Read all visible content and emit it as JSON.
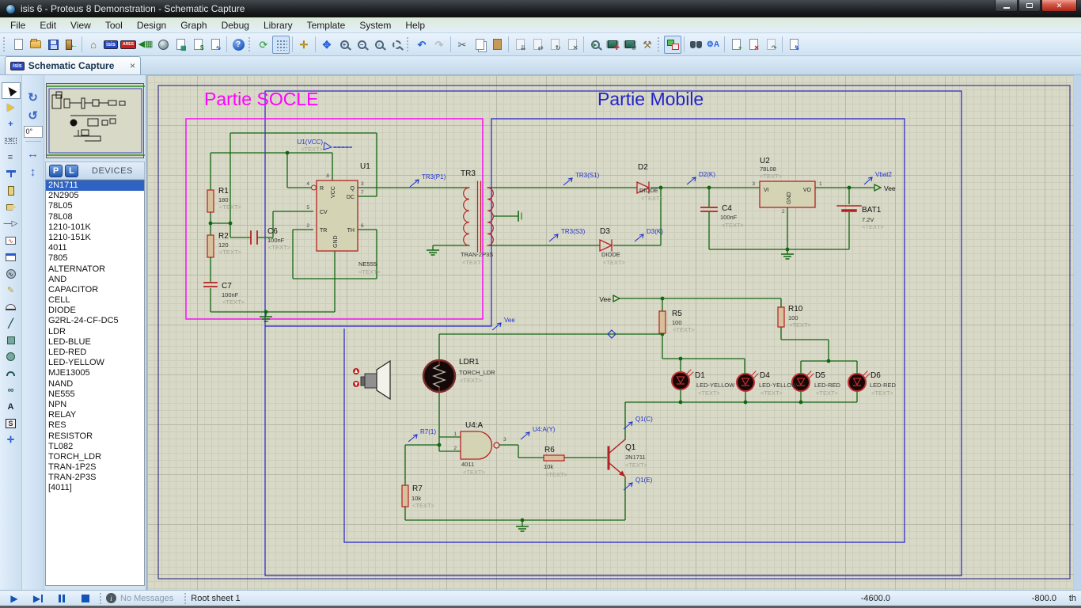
{
  "window": {
    "title": "isis 6 - Proteus 8 Demonstration - Schematic Capture"
  },
  "menu": {
    "items": [
      "File",
      "Edit",
      "View",
      "Tool",
      "Design",
      "Graph",
      "Debug",
      "Library",
      "Template",
      "System",
      "Help"
    ]
  },
  "toolbar": {
    "isis_badge": "isis",
    "ares_badge": "ARES"
  },
  "tab": {
    "label": "Schematic Capture",
    "close": "×"
  },
  "sidebar": {
    "rotation_angle": "0°",
    "p_button": "P",
    "l_button": "L",
    "devices_header": "DEVICES",
    "selected_device": "2N1711",
    "devices": [
      "2N1711",
      "2N2905",
      "78L05",
      "78L08",
      "1210-101K",
      "1210-151K",
      "4011",
      "7805",
      "ALTERNATOR",
      "AND",
      "CAPACITOR",
      "CELL",
      "DIODE",
      "G2RL-24-CF-DC5",
      "LDR",
      "LED-BLUE",
      "LED-RED",
      "LED-YELLOW",
      "MJE13005",
      "NAND",
      "NE555",
      "NPN",
      "RELAY",
      "RES",
      "RESISTOR",
      "TL082",
      "TORCH_LDR",
      "TRAN-1P2S",
      "TRAN-2P3S",
      "[4011]"
    ]
  },
  "statusbar": {
    "message": "No Messages",
    "sheet": "Root sheet 1",
    "coord_x": "-4600.0",
    "coord_y": "-800.0",
    "units": "th"
  },
  "schematic": {
    "titles": {
      "socle": "Partie SOCLE",
      "mobile": "Partie Mobile"
    },
    "placeholder": "<TEXT>",
    "components": [
      {
        "ref": "R1",
        "val": "180"
      },
      {
        "ref": "R2",
        "val": "120"
      },
      {
        "ref": "C6",
        "val": "100nF"
      },
      {
        "ref": "C7",
        "val": "100nF"
      },
      {
        "ref": "U1",
        "val": "NE555"
      },
      {
        "ref": "TR3",
        "val": "TRAN-2P3S"
      },
      {
        "ref": "D2",
        "val": "DIODE"
      },
      {
        "ref": "D3",
        "val": "DIODE"
      },
      {
        "ref": "C4",
        "val": "100nF"
      },
      {
        "ref": "U2",
        "val": "78L08"
      },
      {
        "ref": "BAT1",
        "val": "7.2V"
      },
      {
        "ref": "R5",
        "val": "100"
      },
      {
        "ref": "R10",
        "val": "100"
      },
      {
        "ref": "LDR1",
        "val": "TORCH_LDR"
      },
      {
        "ref": "D1",
        "val": "LED-YELLOW"
      },
      {
        "ref": "D4",
        "val": "LED-YELLOW"
      },
      {
        "ref": "D5",
        "val": "LED-RED"
      },
      {
        "ref": "D6",
        "val": "LED-RED"
      },
      {
        "ref": "U4:A",
        "val": "4011"
      },
      {
        "ref": "R6",
        "val": "10k"
      },
      {
        "ref": "R7",
        "val": "10k"
      },
      {
        "ref": "Q1",
        "val": "2N1711"
      }
    ],
    "u1_pins": {
      "r": "R",
      "cv": "CV",
      "tr": "TR",
      "q": "Q",
      "dc": "DC",
      "th": "TH",
      "vcc": "VCC",
      "gnd": "GND",
      "n4": "4",
      "n5": "5",
      "n2": "2",
      "n8": "8",
      "n3": "3",
      "n7": "7",
      "n6": "6"
    },
    "u2_pins": {
      "vi": "VI",
      "vo": "VO",
      "gnd": "GND",
      "n3": "3",
      "n1": "1",
      "n2": "2"
    },
    "u4_pins": {
      "n1": "1",
      "n2": "2",
      "n3": "3"
    },
    "labels": {
      "u1vcc": "U1(VCC)",
      "tr3p1": "TR3(P1)",
      "tr3s1": "TR3(S1)",
      "tr3s3": "TR3(S3)",
      "d2k": "D2(K)",
      "d3k": "D3(K)",
      "vbat2": "Vbat2",
      "vee": "Vee",
      "r71": "R7(1)",
      "u4ay": "U4:A(Y)",
      "q1c": "Q1(C)",
      "q1e": "Q1(E)"
    }
  },
  "colors": {
    "wire": "#116611",
    "component": "#b22222",
    "label_blue": "#2233cc",
    "region_socle": "#ff00ff",
    "region_mobile": "#2222cc",
    "selection": "#2e63c4"
  }
}
